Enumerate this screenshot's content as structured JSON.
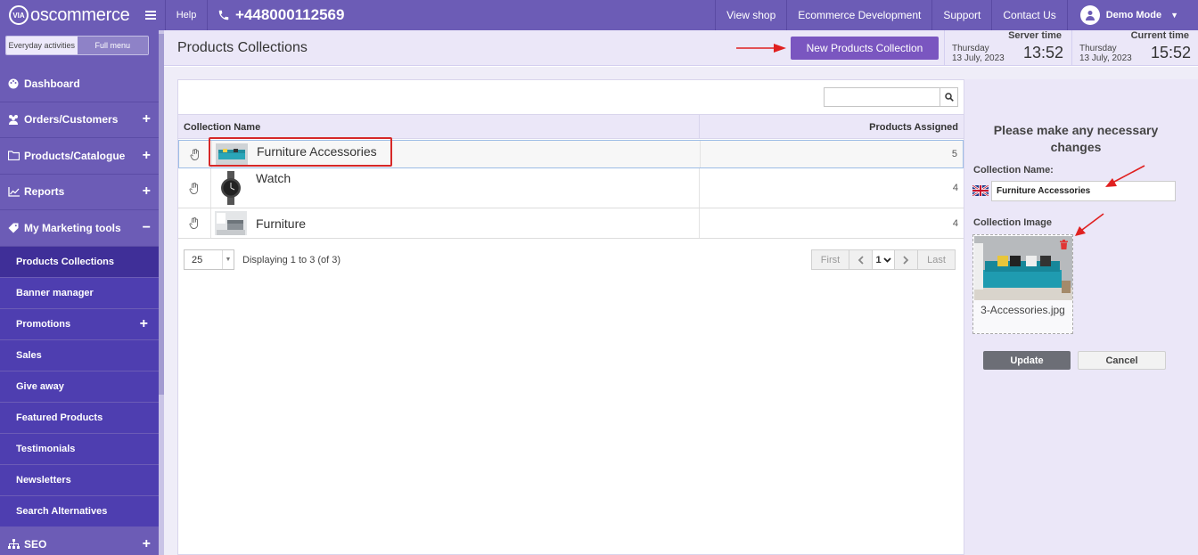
{
  "topbar": {
    "logo_text": "oscommerce",
    "logo_badge": "VIA",
    "help": "Help",
    "phone": "+448000112569",
    "links": [
      "View shop",
      "Ecommerce Development",
      "Support",
      "Contact Us"
    ],
    "user": "Demo Mode"
  },
  "sidebar": {
    "mode_everyday": "Everyday activities",
    "mode_full": "Full menu",
    "items": [
      {
        "label": "Dashboard",
        "icon": "palette-icon",
        "expand": ""
      },
      {
        "label": "Orders/Customers",
        "icon": "users-icon",
        "expand": "+"
      },
      {
        "label": "Products/Catalogue",
        "icon": "folder-icon",
        "expand": "+"
      },
      {
        "label": "Reports",
        "icon": "chart-icon",
        "expand": "+"
      },
      {
        "label": "My Marketing tools",
        "icon": "tag-icon",
        "expand": "−"
      }
    ],
    "subitems": [
      {
        "label": "Products Collections",
        "expand": ""
      },
      {
        "label": "Banner manager",
        "expand": ""
      },
      {
        "label": "Promotions",
        "expand": "+"
      },
      {
        "label": "Sales",
        "expand": ""
      },
      {
        "label": "Give away",
        "expand": ""
      },
      {
        "label": "Featured Products",
        "expand": ""
      },
      {
        "label": "Testimonials",
        "expand": ""
      },
      {
        "label": "Newsletters",
        "expand": ""
      },
      {
        "label": "Search Alternatives",
        "expand": ""
      }
    ],
    "seo": {
      "label": "SEO",
      "expand": "+"
    }
  },
  "header": {
    "page_title": "Products Collections",
    "new_button": "New Products Collection",
    "server_time": {
      "label": "Server time",
      "day": "Thursday",
      "date": "13 July, 2023",
      "time": "13:52"
    },
    "current_time": {
      "label": "Current time",
      "day": "Thursday",
      "date": "13 July, 2023",
      "time": "15:52"
    }
  },
  "table": {
    "columns": [
      "Collection Name",
      "Products Assigned"
    ],
    "rows": [
      {
        "name": "Furniture Accessories",
        "assigned": "5"
      },
      {
        "name": "Watch",
        "assigned": "4"
      },
      {
        "name": "Furniture",
        "assigned": "4"
      }
    ]
  },
  "pager": {
    "per_page": "25",
    "display": "Displaying 1 to 3 (of 3)",
    "first": "First",
    "page": "1",
    "last": "Last"
  },
  "edit": {
    "title": "Please make any necessary changes",
    "name_label": "Collection Name:",
    "name_value": "Furniture Accessories",
    "image_label": "Collection Image",
    "image_file": "3-Accessories.jpg",
    "update": "Update",
    "cancel": "Cancel"
  },
  "colors": {
    "brand": "#6c5cb6",
    "sidebar_sub": "#4e3eb0",
    "accent_button": "#7a56c0",
    "annotation_red": "#d62828"
  }
}
